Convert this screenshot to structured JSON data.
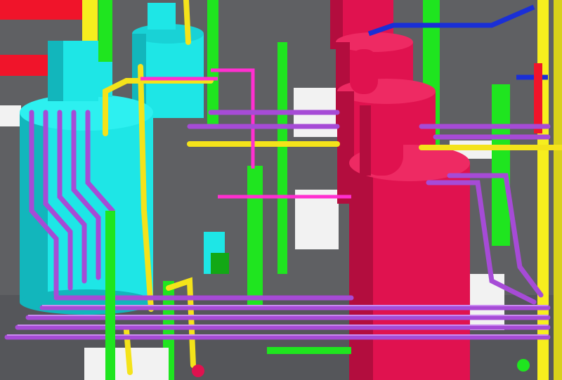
{
  "scene": {
    "description_visible_text": "",
    "palette": {
      "floor": "#5f6063",
      "floor_dark": "#4a4b4e",
      "vessel_red": "#e0124f",
      "vessel_red_shade": "#b30d3e",
      "vessel_cyan": "#1ee6e6",
      "vessel_cyan_shade": "#12b6bc",
      "pipe_purple": "#a64bd6",
      "pipe_purple_shade": "#7a2fa6",
      "pipe_yellow": "#f4e31a",
      "steel_green": "#1fe51f",
      "steel_green_shade": "#12a815",
      "pipe_blue": "#1a2fd6",
      "pipe_magenta": "#ff2fd0",
      "equipment_white": "#f2f2f2",
      "duct_red": "#f0142a",
      "structure_yellow": "#f7ee1e"
    }
  }
}
